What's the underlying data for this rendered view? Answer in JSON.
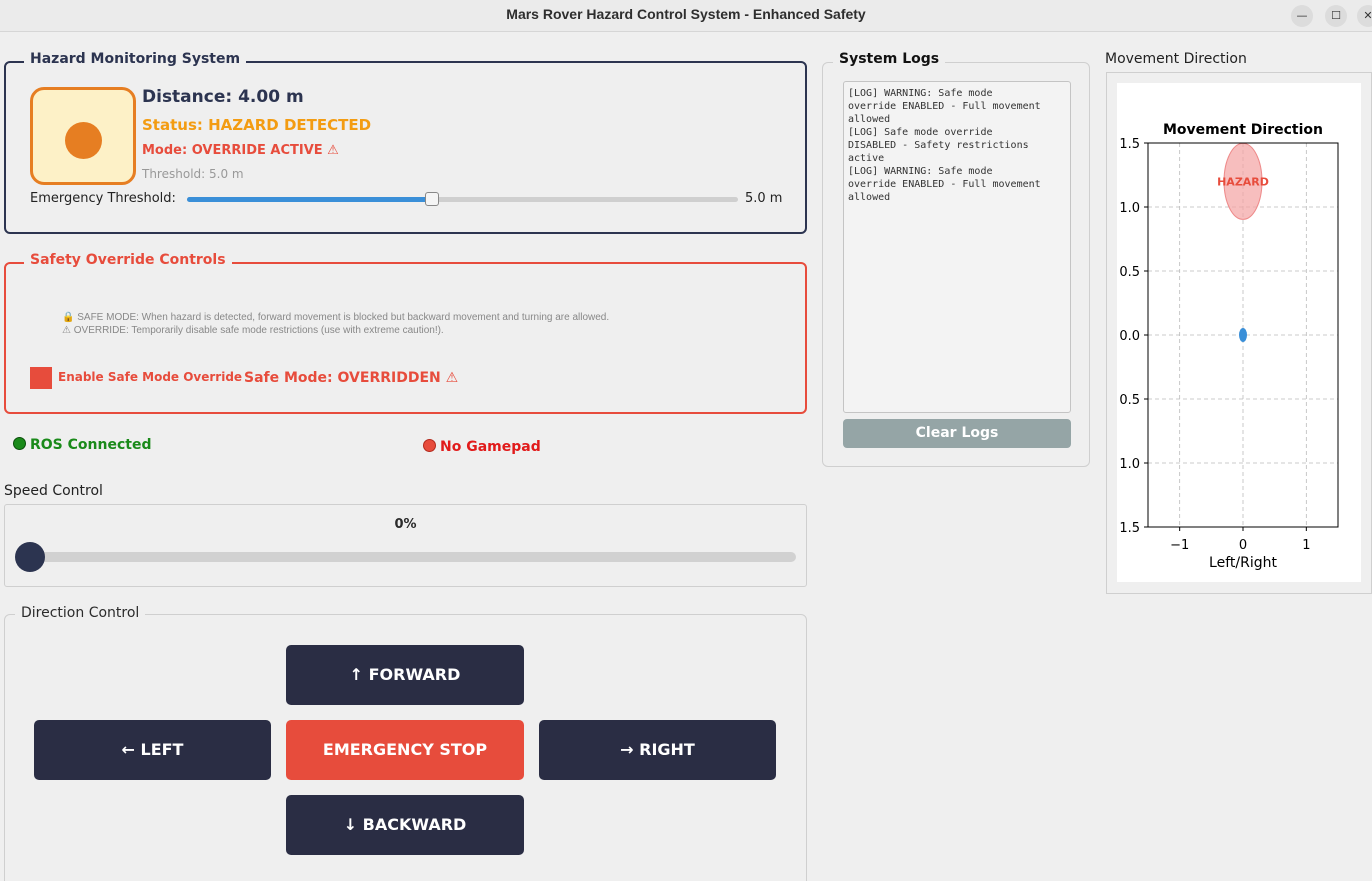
{
  "window": {
    "title": "Mars Rover Hazard Control System - Enhanced Safety",
    "minimize_icon": "minimize-icon",
    "maximize_icon": "maximize-icon",
    "close_icon": "close-icon"
  },
  "hazard": {
    "group_title": "Hazard Monitoring System",
    "distance": "Distance: 4.00 m",
    "status": "Status: HAZARD DETECTED",
    "mode": "Mode: OVERRIDE ACTIVE ⚠",
    "threshold_small": "Threshold: 5.0 m",
    "threshold_label": "Emergency Threshold:",
    "threshold_value": "5.0 m",
    "threshold_slider_fraction": 0.445,
    "status_color": "#f39c12",
    "icon_color": "#e67e22"
  },
  "safety": {
    "group_title": "Safety Override Controls",
    "info_line1": "🔒 SAFE MODE: When hazard is detected, forward movement is blocked but backward movement and turning are allowed.",
    "info_line2": "⚠  OVERRIDE: Temporarily disable safe mode restrictions (use with extreme caution!).",
    "checkbox_label": "Enable Safe Mode Override",
    "checkbox_checked": true,
    "safe_mode_status": "Safe Mode: OVERRIDDEN ⚠",
    "accent_color": "#e74c3c"
  },
  "connection": {
    "ros": "ROS Connected",
    "ros_color": "#1a8a1a",
    "gamepad": "No Gamepad",
    "gamepad_color": "#e11b1b"
  },
  "speed": {
    "label": "Speed Control",
    "percent": "0%",
    "value_fraction": 0
  },
  "direction": {
    "label": "Direction Control",
    "forward": "↑ FORWARD",
    "left": "← LEFT",
    "stop": "EMERGENCY STOP",
    "right": "→ RIGHT",
    "backward": "↓ BACKWARD"
  },
  "logs": {
    "group_title": "System Logs",
    "text": "[LOG] WARNING: Safe mode\noverride ENABLED - Full movement\nallowed\n[LOG] Safe mode override\nDISABLED - Safety restrictions\nactive\n[LOG] WARNING: Safe mode\noverride ENABLED - Full movement\nallowed",
    "clear_button": "Clear Logs"
  },
  "plot_panel": {
    "label": "Movement Direction"
  },
  "chart_data": {
    "type": "scatter",
    "title": "Movement Direction",
    "xlabel": "Left/Right",
    "ylabel": "",
    "xlim": [
      -1.5,
      1.5
    ],
    "ylim": [
      -1.5,
      1.5
    ],
    "x_ticks": [
      "−1",
      "0",
      "1"
    ],
    "x_tick_values": [
      -1,
      0,
      1
    ],
    "y_ticks": [
      "1.5",
      "1.0",
      "0.5",
      "0.0",
      "0.5",
      "1.0",
      "1.5"
    ],
    "y_tick_values": [
      1.5,
      1.0,
      0.5,
      0.0,
      -0.5,
      -1.0,
      -1.5
    ],
    "grid": true,
    "points": [
      {
        "x": 0,
        "y": 0,
        "color": "#3a8fd8"
      }
    ],
    "hazard": {
      "x": 0,
      "y": 1.2,
      "label": "HAZARD",
      "color": "#f4a3a3",
      "label_color": "#e74c3c"
    }
  }
}
